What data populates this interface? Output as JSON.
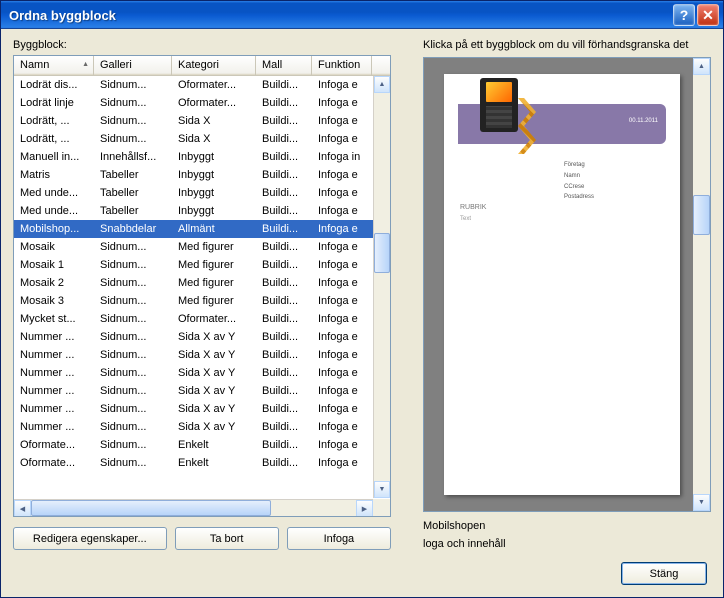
{
  "window": {
    "title": "Ordna byggblock"
  },
  "labels": {
    "byggblock": "Byggblock:",
    "preview_hint": "Klicka på ett byggblock om du vill förhandsgranska det"
  },
  "columns": [
    "Namn",
    "Galleri",
    "Kategori",
    "Mall",
    "Funktion"
  ],
  "rows": [
    {
      "cells": [
        "Lodrät dis...",
        "Sidnum...",
        "Oformater...",
        "Buildi...",
        "Infoga e"
      ],
      "selected": false
    },
    {
      "cells": [
        "Lodrät linje",
        "Sidnum...",
        "Oformater...",
        "Buildi...",
        "Infoga e"
      ],
      "selected": false
    },
    {
      "cells": [
        "Lodrätt, ...",
        "Sidnum...",
        "Sida X",
        "Buildi...",
        "Infoga e"
      ],
      "selected": false
    },
    {
      "cells": [
        "Lodrätt, ...",
        "Sidnum...",
        "Sida X",
        "Buildi...",
        "Infoga e"
      ],
      "selected": false
    },
    {
      "cells": [
        "Manuell in...",
        "Innehållsf...",
        "Inbyggt",
        "Buildi...",
        "Infoga in"
      ],
      "selected": false
    },
    {
      "cells": [
        "Matris",
        "Tabeller",
        "Inbyggt",
        "Buildi...",
        "Infoga e"
      ],
      "selected": false
    },
    {
      "cells": [
        "Med unde...",
        "Tabeller",
        "Inbyggt",
        "Buildi...",
        "Infoga e"
      ],
      "selected": false
    },
    {
      "cells": [
        "Med unde...",
        "Tabeller",
        "Inbyggt",
        "Buildi...",
        "Infoga e"
      ],
      "selected": false
    },
    {
      "cells": [
        "Mobilshop...",
        "Snabbdelar",
        "Allmänt",
        "Buildi...",
        "Infoga e"
      ],
      "selected": true
    },
    {
      "cells": [
        "Mosaik",
        "Sidnum...",
        "Med figurer",
        "Buildi...",
        "Infoga e"
      ],
      "selected": false
    },
    {
      "cells": [
        "Mosaik 1",
        "Sidnum...",
        "Med figurer",
        "Buildi...",
        "Infoga e"
      ],
      "selected": false
    },
    {
      "cells": [
        "Mosaik 2",
        "Sidnum...",
        "Med figurer",
        "Buildi...",
        "Infoga e"
      ],
      "selected": false
    },
    {
      "cells": [
        "Mosaik 3",
        "Sidnum...",
        "Med figurer",
        "Buildi...",
        "Infoga e"
      ],
      "selected": false
    },
    {
      "cells": [
        "Mycket st...",
        "Sidnum...",
        "Oformater...",
        "Buildi...",
        "Infoga e"
      ],
      "selected": false
    },
    {
      "cells": [
        "Nummer ...",
        "Sidnum...",
        "Sida X av Y",
        "Buildi...",
        "Infoga e"
      ],
      "selected": false
    },
    {
      "cells": [
        "Nummer ...",
        "Sidnum...",
        "Sida X av Y",
        "Buildi...",
        "Infoga e"
      ],
      "selected": false
    },
    {
      "cells": [
        "Nummer ...",
        "Sidnum...",
        "Sida X av Y",
        "Buildi...",
        "Infoga e"
      ],
      "selected": false
    },
    {
      "cells": [
        "Nummer ...",
        "Sidnum...",
        "Sida X av Y",
        "Buildi...",
        "Infoga e"
      ],
      "selected": false
    },
    {
      "cells": [
        "Nummer ...",
        "Sidnum...",
        "Sida X av Y",
        "Buildi...",
        "Infoga e"
      ],
      "selected": false
    },
    {
      "cells": [
        "Nummer ...",
        "Sidnum...",
        "Sida X av Y",
        "Buildi...",
        "Infoga e"
      ],
      "selected": false
    },
    {
      "cells": [
        "Oformate...",
        "Sidnum...",
        "Enkelt",
        "Buildi...",
        "Infoga e"
      ],
      "selected": false
    },
    {
      "cells": [
        "Oformate...",
        "Sidnum...",
        "Enkelt",
        "Buildi...",
        "Infoga e"
      ],
      "selected": false
    }
  ],
  "buttons": {
    "edit_props": "Redigera egenskaper...",
    "delete": "Ta bort",
    "insert": "Infoga",
    "close": "Stäng"
  },
  "preview": {
    "name": "Mobilshopen",
    "desc": "loga och innehåll",
    "doc_date": "00.11.2011",
    "meta": [
      "Företag",
      "Namn",
      "CCrese",
      "Postadress"
    ],
    "rubrik": "RUBRIK",
    "text": "Text"
  }
}
